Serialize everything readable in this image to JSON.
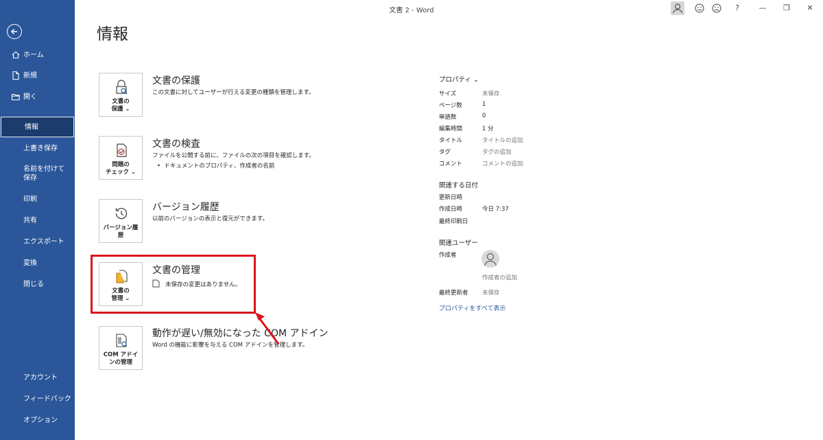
{
  "window": {
    "title": "文書 2  -  Word",
    "controls": {
      "help": "?",
      "minimize": "—",
      "restore": "❐",
      "close": "✕"
    }
  },
  "sidebar": {
    "items": [
      {
        "label": "ホーム",
        "icon": "home-icon"
      },
      {
        "label": "新規",
        "icon": "new-document-icon"
      },
      {
        "label": "開く",
        "icon": "open-folder-icon"
      },
      {
        "label": "情報"
      },
      {
        "label": "上書き保存"
      },
      {
        "label": "名前を付けて保存"
      },
      {
        "label": "印刷"
      },
      {
        "label": "共有"
      },
      {
        "label": "エクスポート"
      },
      {
        "label": "変換"
      },
      {
        "label": "閉じる"
      }
    ],
    "bottom_items": [
      {
        "label": "アカウント"
      },
      {
        "label": "フィードバック"
      },
      {
        "label": "オプション"
      }
    ],
    "active": "情報",
    "colors": {
      "background": "#2b579a",
      "active": "#1b3c6d"
    }
  },
  "page": {
    "title": "情報"
  },
  "cards": [
    {
      "button_label": "文書の\n保護 ⌄",
      "icon": "lock-search-icon",
      "title": "文書の保護",
      "description": [
        "この文書に対してユーザーが行える変更の種類を管理します。"
      ]
    },
    {
      "button_label": "問題の\nチェック ⌄",
      "icon": "inspect-document-icon",
      "title": "文書の検査",
      "description": [
        "ファイルを公開する前に、ファイルの次の項目を確認します。",
        "ドキュメントのプロパティ、作成者の名前"
      ]
    },
    {
      "button_label": "バージョン履\n歴",
      "icon": "version-history-icon",
      "title": "バージョン履歴",
      "description": [
        "以前のバージョンの表示と復元ができます。"
      ]
    },
    {
      "button_label": "文書の\n管理 ⌄",
      "icon": "manage-document-icon",
      "title": "文書の管理",
      "description": [
        "未保存の変更はありません。"
      ]
    },
    {
      "button_label": "COM アドイ\nンの管理",
      "icon": "com-addin-icon",
      "title": "動作が遅い/無効になった COM アドイン",
      "description": [
        "Word の機能に影響を与える COM アドインを管理します。"
      ]
    }
  ],
  "properties": {
    "header": "プロパティ ⌄",
    "rows": [
      {
        "label": "サイズ",
        "value": "未保存",
        "muted": true
      },
      {
        "label": "ページ数",
        "value": "1"
      },
      {
        "label": "単語数",
        "value": "0"
      },
      {
        "label": "編集時間",
        "value": "1 分"
      },
      {
        "label": "タイトル",
        "value": "タイトルの追加",
        "muted": true
      },
      {
        "label": "タグ",
        "value": "タグの追加",
        "muted": true
      },
      {
        "label": "コメント",
        "value": "コメントの追加",
        "muted": true
      }
    ],
    "dates_header": "関連する日付",
    "dates": [
      {
        "label": "更新日時",
        "value": ""
      },
      {
        "label": "作成日時",
        "value": "今日 7:37"
      },
      {
        "label": "最終印刷日",
        "value": ""
      }
    ],
    "people_header": "関連ユーザー",
    "author_label": "作成者",
    "author_add": "作成者の追加",
    "last_modified_label": "最終更新者",
    "last_modified_value": "未保存",
    "show_all": "プロパティをすべて表示"
  },
  "annotation": {
    "highlight_color": "#d9161c"
  }
}
